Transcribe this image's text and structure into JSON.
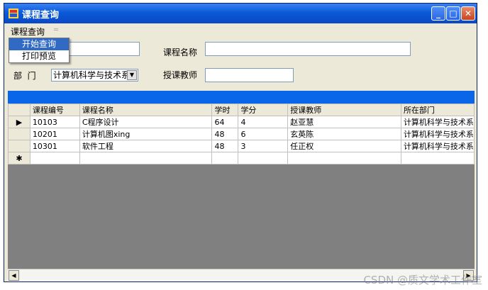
{
  "window": {
    "title": "课程查询",
    "minimize_glyph": "_",
    "maximize_glyph": "□",
    "close_glyph": "✕"
  },
  "menubar": {
    "menu_label": "课程查询",
    "more_glyph": "═"
  },
  "dropdown": {
    "items": [
      "开始查询",
      "打印预览"
    ],
    "selected": 0
  },
  "form": {
    "course_name_label": "课程名称",
    "course_name_value": "",
    "dept_label": "部  门",
    "dept_value": "计算机科学与技术系",
    "teacher_label": "授课教师",
    "teacher_value": "",
    "id_value": ""
  },
  "table": {
    "columns": [
      "课程编号",
      "课程名称",
      "学时",
      "学分",
      "授课教师",
      "所在部门"
    ],
    "rows": [
      [
        "10103",
        "C程序设计",
        "64",
        "4",
        "赵亚慧",
        "计算机科学与技术系"
      ],
      [
        "10201",
        "计算机图xing",
        "48",
        "6",
        "玄英陈",
        "计算机科学与技术系"
      ],
      [
        "10301",
        "软件工程",
        "48",
        "3",
        "任正权",
        "计算机科学与技术系"
      ]
    ],
    "current_row_marker": "▶",
    "new_row_marker": "✱"
  },
  "scroll": {
    "left_glyph": "◀",
    "right_glyph": "▶"
  },
  "watermark": "CSDN @质文学术工作室",
  "colors": {
    "titlebar": "#0a5ad8",
    "band": "#0a66e8",
    "selection": "#316ac5",
    "grid_bg": "#808080"
  }
}
